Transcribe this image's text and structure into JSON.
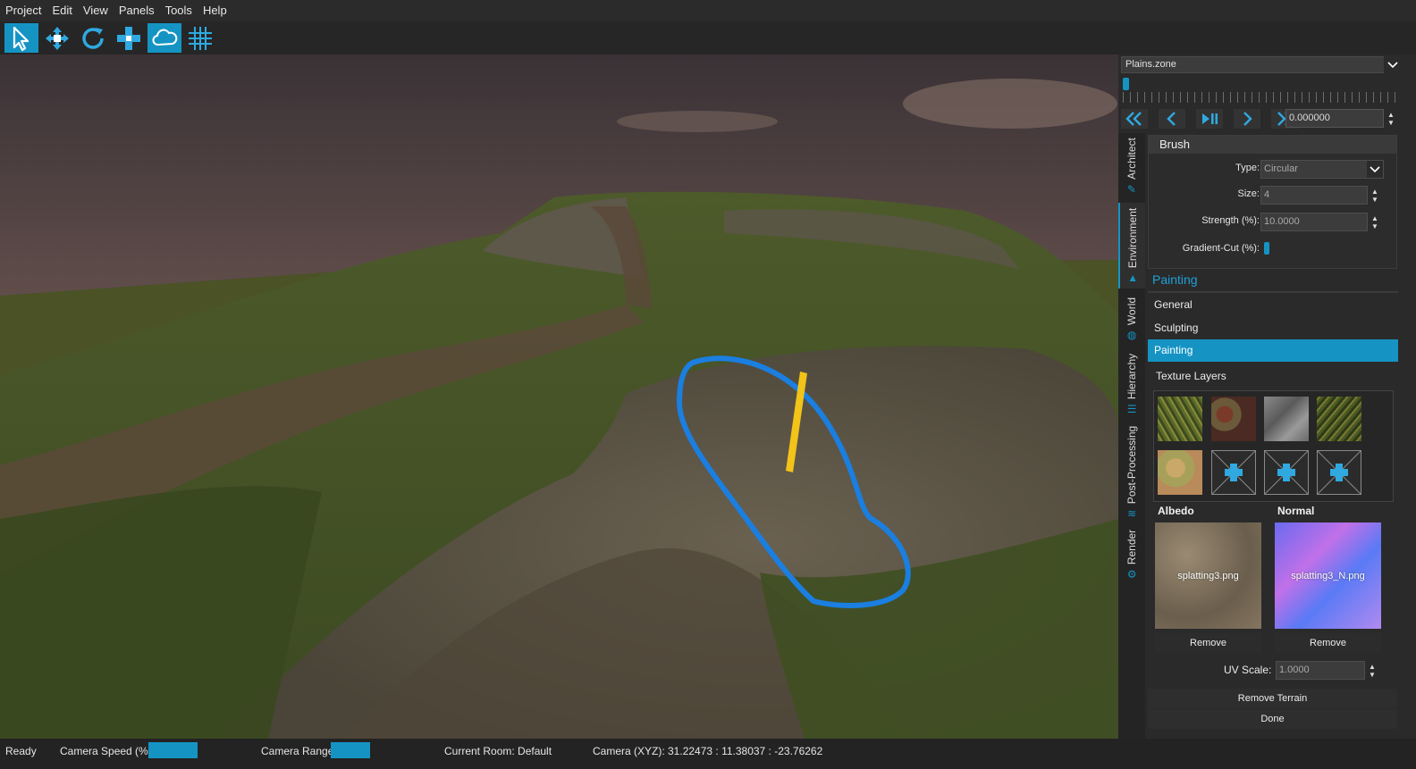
{
  "menu": [
    "Project",
    "Edit",
    "View",
    "Panels",
    "Tools",
    "Help"
  ],
  "toolbar": {
    "tools": [
      {
        "name": "select-tool-icon",
        "active": true
      },
      {
        "name": "move-tool-icon",
        "active": false
      },
      {
        "name": "rotate-tool-icon",
        "active": false
      },
      {
        "name": "scale-tool-icon",
        "active": false
      },
      {
        "name": "cloud-tool-icon",
        "active": true
      },
      {
        "name": "grid-tool-icon",
        "active": false
      }
    ]
  },
  "panel": {
    "zone": "Plains.zone",
    "time_value": "0.000000",
    "tabs": [
      "Architect",
      "Environment",
      "World",
      "Hierarchy",
      "Post-Processing",
      "Render"
    ],
    "active_tab": "Environment",
    "brush": {
      "title": "Brush",
      "type_label": "Type:",
      "type_value": "Circular",
      "size_label": "Size:",
      "size_value": "4",
      "strength_label": "Strength (%):",
      "strength_value": "10.0000",
      "gradient_label": "Gradient-Cut (%):"
    },
    "section_title": "Painting",
    "nav": [
      "General",
      "Sculpting",
      "Painting"
    ],
    "active_nav": "Painting",
    "texture_layers_label": "Texture Layers",
    "albedo_label": "Albedo",
    "normal_label": "Normal",
    "albedo_file": "splatting3.png",
    "normal_file": "splatting3_N.png",
    "remove_label": "Remove",
    "uv_label": "UV Scale:",
    "uv_value": "1.0000",
    "remove_terrain": "Remove Terrain",
    "done": "Done"
  },
  "status": {
    "ready": "Ready",
    "camera_speed": "Camera  Speed (%):",
    "camera_range": "Camera Range:",
    "room": "Current Room: Default",
    "camera_xyz": "Camera (XYZ):  31.22473 : 11.38037 : -23.76262"
  },
  "colors": {
    "accent": "#1594c4",
    "brush_circle": "#1a7fe0",
    "brush_marker": "#f2c318"
  }
}
